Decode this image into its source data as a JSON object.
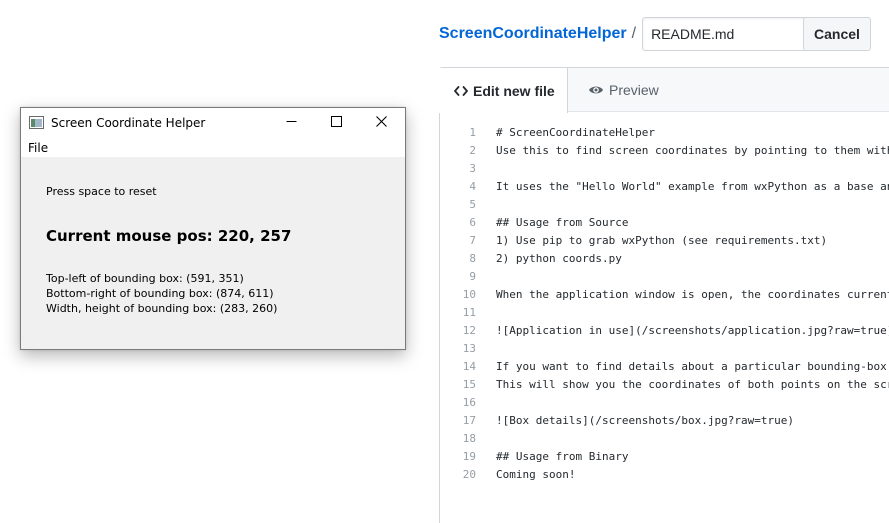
{
  "github": {
    "repo_name": "ScreenCoordinateHelper",
    "path_separator": "/",
    "filename": "README.md",
    "cancel_label": "Cancel",
    "tabs": [
      {
        "label": "Edit new file",
        "icon": "code-icon",
        "active": true
      },
      {
        "label": "Preview",
        "icon": "eye-icon",
        "active": false
      }
    ],
    "code_lines": [
      {
        "num": "1",
        "text": "# ScreenCoordinateHelper"
      },
      {
        "num": "2",
        "text": "Use this to find screen coordinates by pointing to them with"
      },
      {
        "num": "3",
        "text": ""
      },
      {
        "num": "4",
        "text": "It uses the \"Hello World\" example from wxPython as a base an"
      },
      {
        "num": "5",
        "text": ""
      },
      {
        "num": "6",
        "text": "## Usage from Source"
      },
      {
        "num": "7",
        "text": "1) Use pip to grab wxPython (see requirements.txt)"
      },
      {
        "num": "8",
        "text": "2) python coords.py"
      },
      {
        "num": "9",
        "text": ""
      },
      {
        "num": "10",
        "text": "When the application window is open, the coordinates current"
      },
      {
        "num": "11",
        "text": ""
      },
      {
        "num": "12",
        "text": "![Application in use](/screenshots/application.jpg?raw=true)"
      },
      {
        "num": "13",
        "text": ""
      },
      {
        "num": "14",
        "text": "If you want to find details about a particular bounding-box,"
      },
      {
        "num": "15",
        "text": "This will show you the coordinates of both points on the scr"
      },
      {
        "num": "16",
        "text": ""
      },
      {
        "num": "17",
        "text": "![Box details](/screenshots/box.jpg?raw=true)"
      },
      {
        "num": "18",
        "text": ""
      },
      {
        "num": "19",
        "text": "## Usage from Binary"
      },
      {
        "num": "20",
        "text": "Coming soon!"
      }
    ]
  },
  "wx_window": {
    "title": "Screen Coordinate Helper",
    "menu_file": "File",
    "reset_hint": "Press space to reset",
    "mouse_pos": "Current mouse pos: 220, 257",
    "top_left": "Top-left of bounding box: (591, 351)",
    "bottom_right": "Bottom-right of bounding box: (874, 611)",
    "width_height": "Width, height of bounding box: (283, 260)"
  },
  "colors": {
    "link_blue": "#0366d6",
    "line_number_gray": "#959da5",
    "wx_background": "#f0f0f0"
  }
}
